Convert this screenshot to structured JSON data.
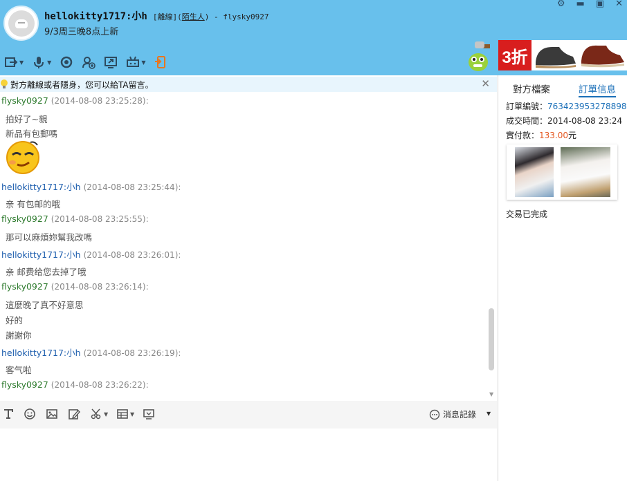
{
  "header": {
    "nickname": "hellokitty1717:小h",
    "status_prefix": "[離線](",
    "relation": "陌生人",
    "status_suffix": ")",
    "separator": " - ",
    "my_account": "flysky0927",
    "signature": "9/3周三晚8点上新",
    "window_controls": [
      "gear-icon",
      "minimize-icon",
      "maximize-icon",
      "close-icon"
    ]
  },
  "toolbar": {
    "icons": [
      "transfer-file-icon",
      "voice-icon",
      "video-icon",
      "add-contact-icon",
      "screen-share-icon",
      "remote-assist-icon",
      "mobile-icon"
    ]
  },
  "ad": {
    "discount": "3折"
  },
  "notice": {
    "text": "對方離線或者隱身，您可以給TA留言。"
  },
  "messages": [
    {
      "sender": "flysky0927",
      "time": "(2014-08-08 23:25:28):",
      "role": "peer",
      "lines": [
        "拍好了~親",
        "新品有包郵嗎"
      ],
      "emoji": true
    },
    {
      "sender": "hellokitty1717:小h",
      "time": "(2014-08-08 23:25:44):",
      "role": "me",
      "lines": [
        "亲 有包邮的哦"
      ]
    },
    {
      "sender": "flysky0927",
      "time": "(2014-08-08 23:25:55):",
      "role": "peer",
      "lines": [
        "那可以麻煩妳幫我改嗎"
      ]
    },
    {
      "sender": "hellokitty1717:小h",
      "time": "(2014-08-08 23:26:01):",
      "role": "me",
      "lines": [
        "亲 邮费给您去掉了哦"
      ]
    },
    {
      "sender": "flysky0927",
      "time": "(2014-08-08 23:26:14):",
      "role": "peer",
      "lines": [
        "這麼晚了真不好意思",
        "好的",
        "謝謝你"
      ]
    },
    {
      "sender": "hellokitty1717:小h",
      "time": "(2014-08-08 23:26:19):",
      "role": "me",
      "lines": [
        "客气啦"
      ]
    },
    {
      "sender": "flysky0927",
      "time": "(2014-08-08 23:26:22):",
      "role": "peer",
      "lines": []
    }
  ],
  "input_toolbar": {
    "icons": [
      "font-icon",
      "emoji-icon",
      "image-icon",
      "handwriting-icon",
      "screenshot-icon",
      "quick-phrase-icon",
      "remote-screen-icon"
    ],
    "history_label": "消息記錄"
  },
  "side": {
    "tab_profile": "對方檔案",
    "tab_order": "訂單信息",
    "order_no_label": "訂單編號：",
    "order_no": "763423953278898",
    "deal_time_label": "成交時間：",
    "deal_time": "2014-08-08 23:24",
    "paid_label": "實付款：",
    "paid_amount": "133.00",
    "paid_unit": "元",
    "status": "交易已完成"
  }
}
